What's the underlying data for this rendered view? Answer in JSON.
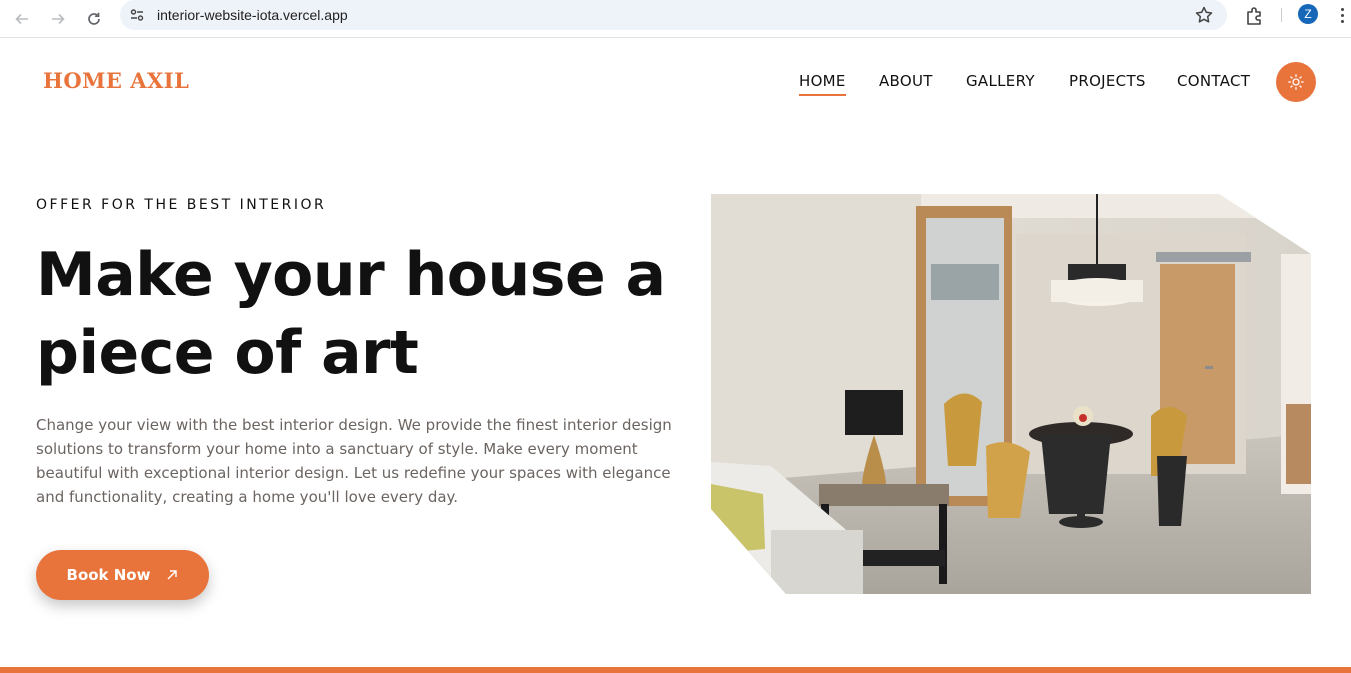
{
  "browser": {
    "url": "interior-website-iota.vercel.app",
    "profile_initial": "Z"
  },
  "site": {
    "logo": "HOME AXIL",
    "nav": [
      "HOME",
      "ABOUT",
      "GALLERY",
      "PROJECTS",
      "CONTACT"
    ],
    "active_nav": "HOME",
    "accent_color": "#e8743c"
  },
  "hero": {
    "eyebrow": "OFFER FOR THE BEST INTERIOR",
    "headline_line1": "Make your house a",
    "headline_line2": "piece of art",
    "description": "Change your view with the best interior design. We provide the finest interior design solutions to transform your home into a sanctuary of style. Make every moment beautiful with exceptional interior design. Let us redefine your spaces with elegance and functionality, creating a home you'll love every day.",
    "cta_label": "Book Now",
    "cta_icon": "arrow-up-right-icon"
  }
}
